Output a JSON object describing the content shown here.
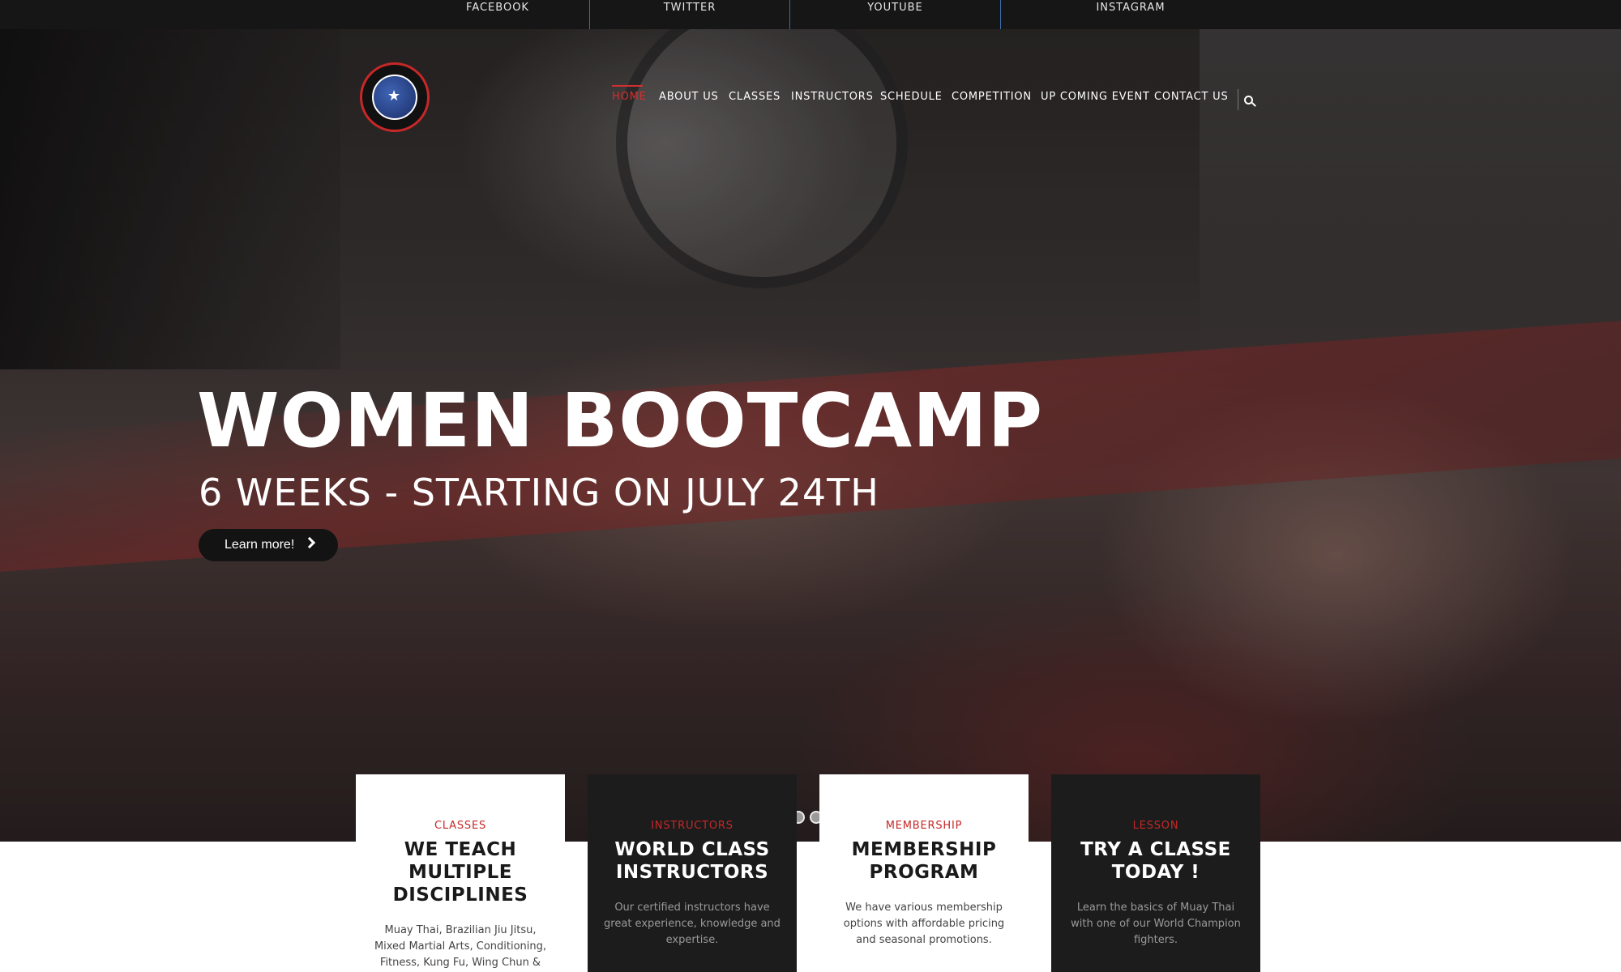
{
  "social": {
    "facebook": "FACEBOOK",
    "twitter": "TWITTER",
    "youtube": "YOUTUBE",
    "instagram": "INSTAGRAM"
  },
  "nav": {
    "items": [
      "HOME",
      "ABOUT US",
      "CLASSES",
      "INSTRUCTORS",
      "SCHEDULE",
      "COMPETITION",
      "UP COMING EVENT",
      "CONTACT US"
    ],
    "active": "HOME"
  },
  "hero": {
    "title": "WOMEN BOOTCAMP",
    "subtitle": "6 WEEKS - STARTING ON JULY 24TH",
    "button_label": "Learn more!",
    "slider_dots": 2
  },
  "cards": [
    {
      "label": "CLASSES",
      "title": "WE TEACH MULTIPLE DISCIPLINES",
      "text": "Muay Thai, Brazilian Jiu Jitsu, Mixed Martial Arts, Conditioning, Fitness, Kung Fu, Wing Chun & Kids",
      "theme": "light"
    },
    {
      "label": "INSTRUCTORS",
      "title": "WORLD CLASS INSTRUCTORS",
      "text": "Our certified instructors have great experience, knowledge and expertise.",
      "theme": "dark"
    },
    {
      "label": "MEMBERSHIP",
      "title": "MEMBERSHIP PROGRAM",
      "text": "We have various membership options with affordable pricing and seasonal promotions.",
      "theme": "light"
    },
    {
      "label": "LESSON",
      "title": "TRY A CLASSE TODAY !",
      "text": "Learn the basics of Muay Thai with one of our World Champion fighters.",
      "theme": "dark"
    }
  ],
  "colors": {
    "accent": "#d32f2f",
    "topbar": "#161616",
    "dark_card": "#1c1c1c"
  }
}
